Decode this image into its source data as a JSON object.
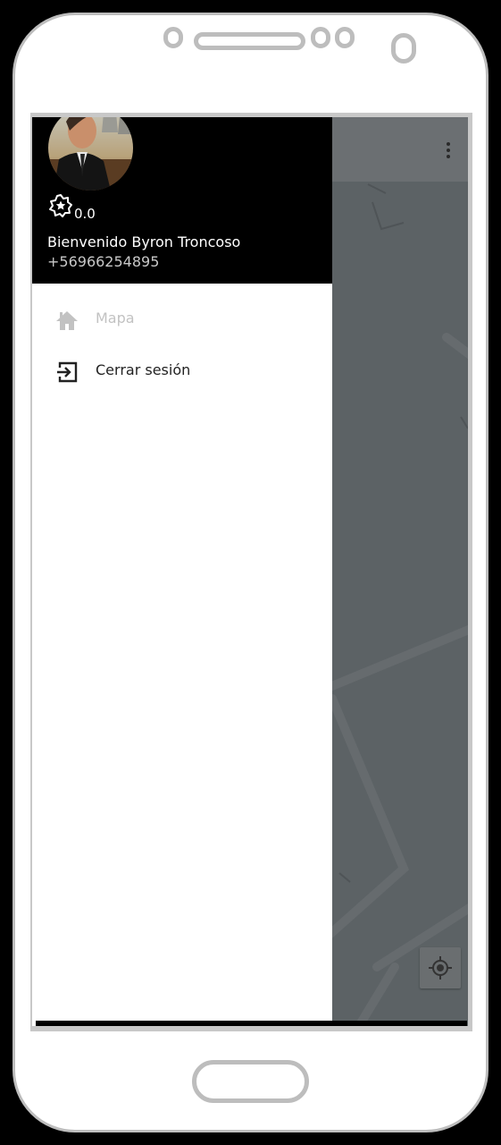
{
  "drawer": {
    "header": {
      "rating": "0.0",
      "welcome": "Bienvenido Byron Troncoso",
      "phone": "+56966254895",
      "background": "#000000"
    },
    "menu": [
      {
        "label": "Mapa",
        "icon": "home-icon",
        "active": false,
        "color": "#c2c2c2"
      },
      {
        "label": "Cerrar sesión",
        "icon": "logout-icon",
        "active": true,
        "color": "#222222"
      }
    ]
  },
  "map": {
    "overlay_color": "#5c6265",
    "menu_icon": "more-vert-icon",
    "locate_icon": "my-location-icon"
  }
}
